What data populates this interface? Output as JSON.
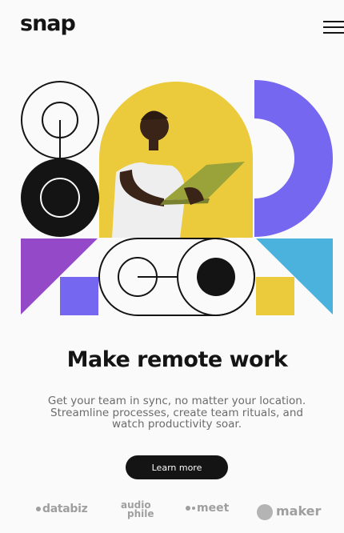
{
  "header": {
    "logo_text": "snap",
    "menu_label": "menu"
  },
  "hero": {
    "headline": "Make remote work",
    "description": "Get your team in sync, no matter your location. Streamline processes, create team rituals, and watch productivity soar.",
    "cta_label": "Learn more"
  },
  "clients": {
    "databiz": "databiz",
    "audiophile_top": "audio",
    "audiophile_bottom": "phile",
    "meet": "meet",
    "maker": "maker"
  },
  "colors": {
    "accent_yellow": "#EBCB3B",
    "accent_purple": "#7567EF",
    "accent_violet": "#9449C9",
    "accent_cyan": "#4BB2DD",
    "ink": "#141414"
  }
}
